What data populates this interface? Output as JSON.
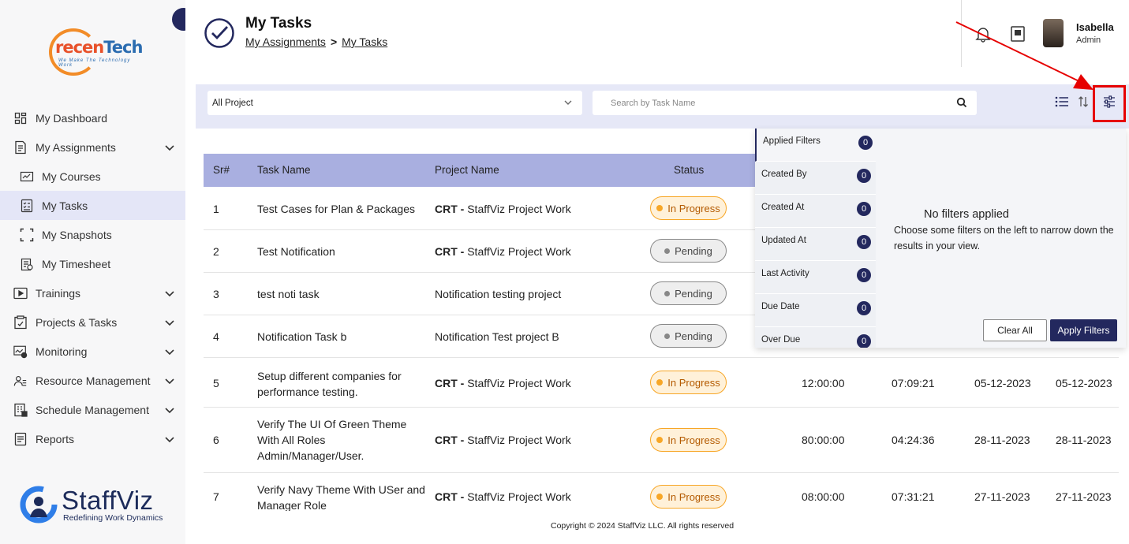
{
  "brand": {
    "logo_text_1": "recen",
    "logo_text_2": "Tech",
    "logo_sub": "We Make The Technology Work",
    "footer_logo": "StaffViz",
    "footer_tag": "Redefining Work Dynamics"
  },
  "header": {
    "title": "My Tasks",
    "breadcrumb_parent": "My Assignments",
    "breadcrumb_sep": ">",
    "breadcrumb_current": "My Tasks"
  },
  "user": {
    "name": "Isabella",
    "role": "Admin"
  },
  "sidebar": {
    "items": [
      {
        "label": "My Dashboard",
        "icon": "dashboard-icon"
      },
      {
        "label": "My Assignments",
        "icon": "assignment-icon"
      },
      {
        "label": "My Courses",
        "icon": "courses-icon"
      },
      {
        "label": "My Tasks",
        "icon": "tasks-icon"
      },
      {
        "label": "My Snapshots",
        "icon": "snapshot-icon"
      },
      {
        "label": "My Timesheet",
        "icon": "timesheet-icon"
      },
      {
        "label": "Trainings",
        "icon": "play-icon"
      },
      {
        "label": "Projects & Tasks",
        "icon": "clipboard-icon"
      },
      {
        "label": "Monitoring",
        "icon": "monitor-icon"
      },
      {
        "label": "Resource Management",
        "icon": "users-icon"
      },
      {
        "label": "Schedule Management",
        "icon": "building-icon"
      },
      {
        "label": "Reports",
        "icon": "report-icon"
      }
    ]
  },
  "toolbar": {
    "project_value": "All Project",
    "search_placeholder": "Search by Task Name"
  },
  "table": {
    "headers": [
      "Sr#",
      "Task Name",
      "Project Name",
      "Status"
    ],
    "rows": [
      {
        "sr": "1",
        "task": "Test Cases for Plan & Packages",
        "project_bold": "CRT -",
        "project": "StaffViz Project Work",
        "status": "In Progress",
        "est": "",
        "spent": "",
        "start": "",
        "due": ""
      },
      {
        "sr": "2",
        "task": "Test Notification",
        "project_bold": "CRT -",
        "project": "StaffViz Project Work",
        "status": "Pending",
        "est": "",
        "spent": "",
        "start": "",
        "due": ""
      },
      {
        "sr": "3",
        "task": "test noti task",
        "project_bold": "",
        "project": "Notification testing project",
        "status": "Pending",
        "est": "",
        "spent": "",
        "start": "",
        "due": ""
      },
      {
        "sr": "4",
        "task": "Notification Task b",
        "project_bold": "",
        "project": "Notification Test project B",
        "status": "Pending",
        "est": "",
        "spent": "",
        "start": "",
        "due": ""
      },
      {
        "sr": "5",
        "task_lines": [
          "Setup different companies for",
          "performance testing."
        ],
        "project_bold": "CRT -",
        "project": "StaffViz Project Work",
        "status": "In Progress",
        "est": "12:00:00",
        "spent": "07:09:21",
        "start": "05-12-2023",
        "due": "05-12-2023"
      },
      {
        "sr": "6",
        "task_lines": [
          "Verify The UI Of Green Theme",
          "With All Roles",
          "Admin/Manager/User."
        ],
        "project_bold": "CRT -",
        "project": "StaffViz Project Work",
        "status": "In Progress",
        "est": "80:00:00",
        "spent": "04:24:36",
        "start": "28-11-2023",
        "due": "28-11-2023"
      },
      {
        "sr": "7",
        "task_lines": [
          "Verify Navy Theme With USer and",
          "Manager Role"
        ],
        "project_bold": "CRT -",
        "project": "StaffViz Project Work",
        "status": "In Progress",
        "est": "08:00:00",
        "spent": "07:31:21",
        "start": "27-11-2023",
        "due": "27-11-2023"
      }
    ]
  },
  "filters": {
    "items": [
      {
        "label": "Applied Filters",
        "count": "0"
      },
      {
        "label": "Created By",
        "count": "0"
      },
      {
        "label": "Created At",
        "count": "0"
      },
      {
        "label": "Updated At",
        "count": "0"
      },
      {
        "label": "Last Activity",
        "count": "0"
      },
      {
        "label": "Due Date",
        "count": "0"
      },
      {
        "label": "Over Due",
        "count": "0"
      }
    ],
    "empty_title": "No filters applied",
    "empty_text": "Choose some filters on the left to narrow down the results in your view.",
    "clear_label": "Clear All",
    "apply_label": "Apply Filters"
  },
  "footer": {
    "copyright": "Copyright © 2024 StaffViz LLC. All rights reserved"
  },
  "colors": {
    "navy": "#23285e",
    "accent": "#a9afe0",
    "progress": "#f7a626",
    "highlight": "#e60000"
  }
}
